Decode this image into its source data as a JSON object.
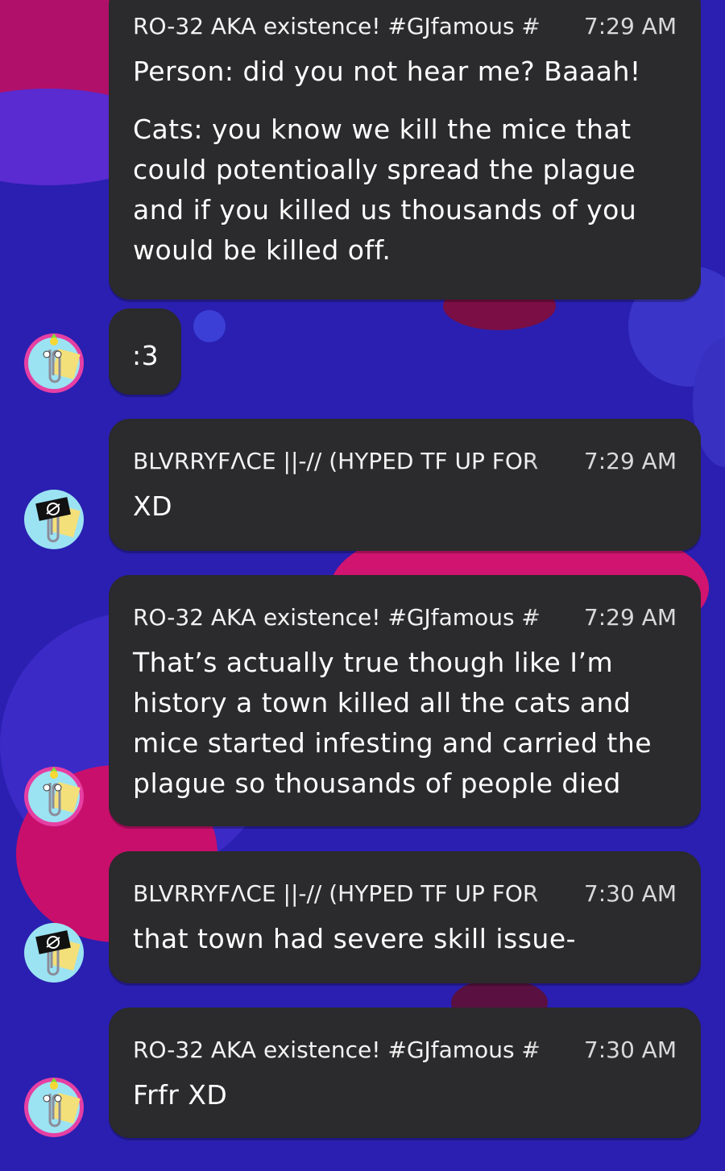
{
  "messages": [
    {
      "name": "RO-32 AKA existence!  #GJfamous #",
      "time": "7:29 AM",
      "paragraphs": [
        "Person: did you not hear me? Baaah!",
        "Cats: you know we kill the mice that could potentioally spread the plague and if you killed us thousands of you would be killed off."
      ]
    },
    {
      "text": ":3"
    },
    {
      "name": "BLVRRYFΛCE ||-// (HYPED TF UP FOR",
      "time": "7:29 AM",
      "text": "XD"
    },
    {
      "name": "RO-32 AKA existence!  #GJfamous #",
      "time": "7:29 AM",
      "text": "That’s actually true though like I’m history a town killed all the cats and mice started infesting and carried the plague so thousands of people died"
    },
    {
      "name": "BLVRRYFΛCE ||-// (HYPED TF UP FOR",
      "time": "7:30 AM",
      "text": "that town had severe skill issue-"
    },
    {
      "name": "RO-32 AKA existence!  #GJfamous #",
      "time": "7:30 AM",
      "text": "Frfr XD"
    }
  ],
  "avatars": {
    "ro32": "paperclip-party-hat-avatar",
    "blvrryface": "paperclip-null-sign-avatar"
  },
  "colors": {
    "background": "#2a1fb0",
    "bubble": "#2b2a2c",
    "accent_pink": "#e0157a"
  }
}
